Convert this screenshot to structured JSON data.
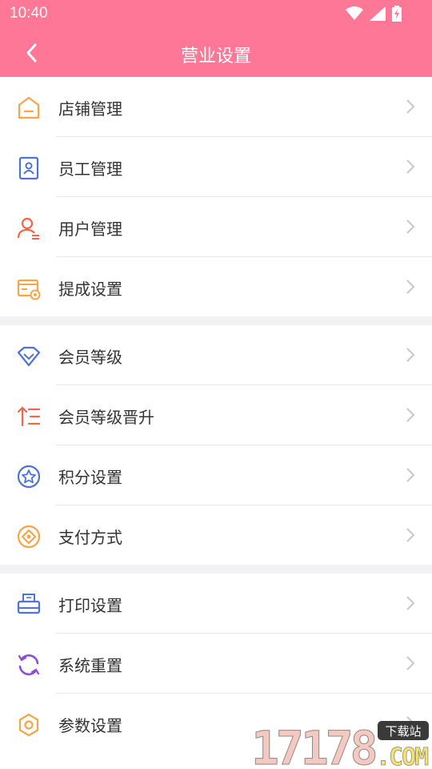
{
  "status_bar": {
    "time": "10:40",
    "icons": [
      "wifi-icon",
      "signal-icon",
      "battery-icon"
    ]
  },
  "header": {
    "title": "营业设置",
    "back_icon": "back-arrow-icon",
    "background": "#ff7797"
  },
  "groups": [
    {
      "items": [
        {
          "label": "店铺管理",
          "icon": "store-icon"
        },
        {
          "label": "员工管理",
          "icon": "staff-badge-icon"
        },
        {
          "label": "用户管理",
          "icon": "user-icon"
        },
        {
          "label": "提成设置",
          "icon": "commission-icon"
        }
      ]
    },
    {
      "items": [
        {
          "label": "会员等级",
          "icon": "diamond-icon"
        },
        {
          "label": "会员等级晋升",
          "icon": "promotion-icon"
        },
        {
          "label": "积分设置",
          "icon": "points-star-icon"
        },
        {
          "label": "支付方式",
          "icon": "payment-icon"
        }
      ]
    },
    {
      "items": [
        {
          "label": "打印设置",
          "icon": "printer-icon"
        },
        {
          "label": "系统重置",
          "icon": "reset-icon"
        },
        {
          "label": "参数设置",
          "icon": "settings-icon"
        }
      ]
    }
  ],
  "watermark": {
    "text_main": "17178",
    "text_badge": "下载站",
    "text_suffix": ".COM"
  }
}
